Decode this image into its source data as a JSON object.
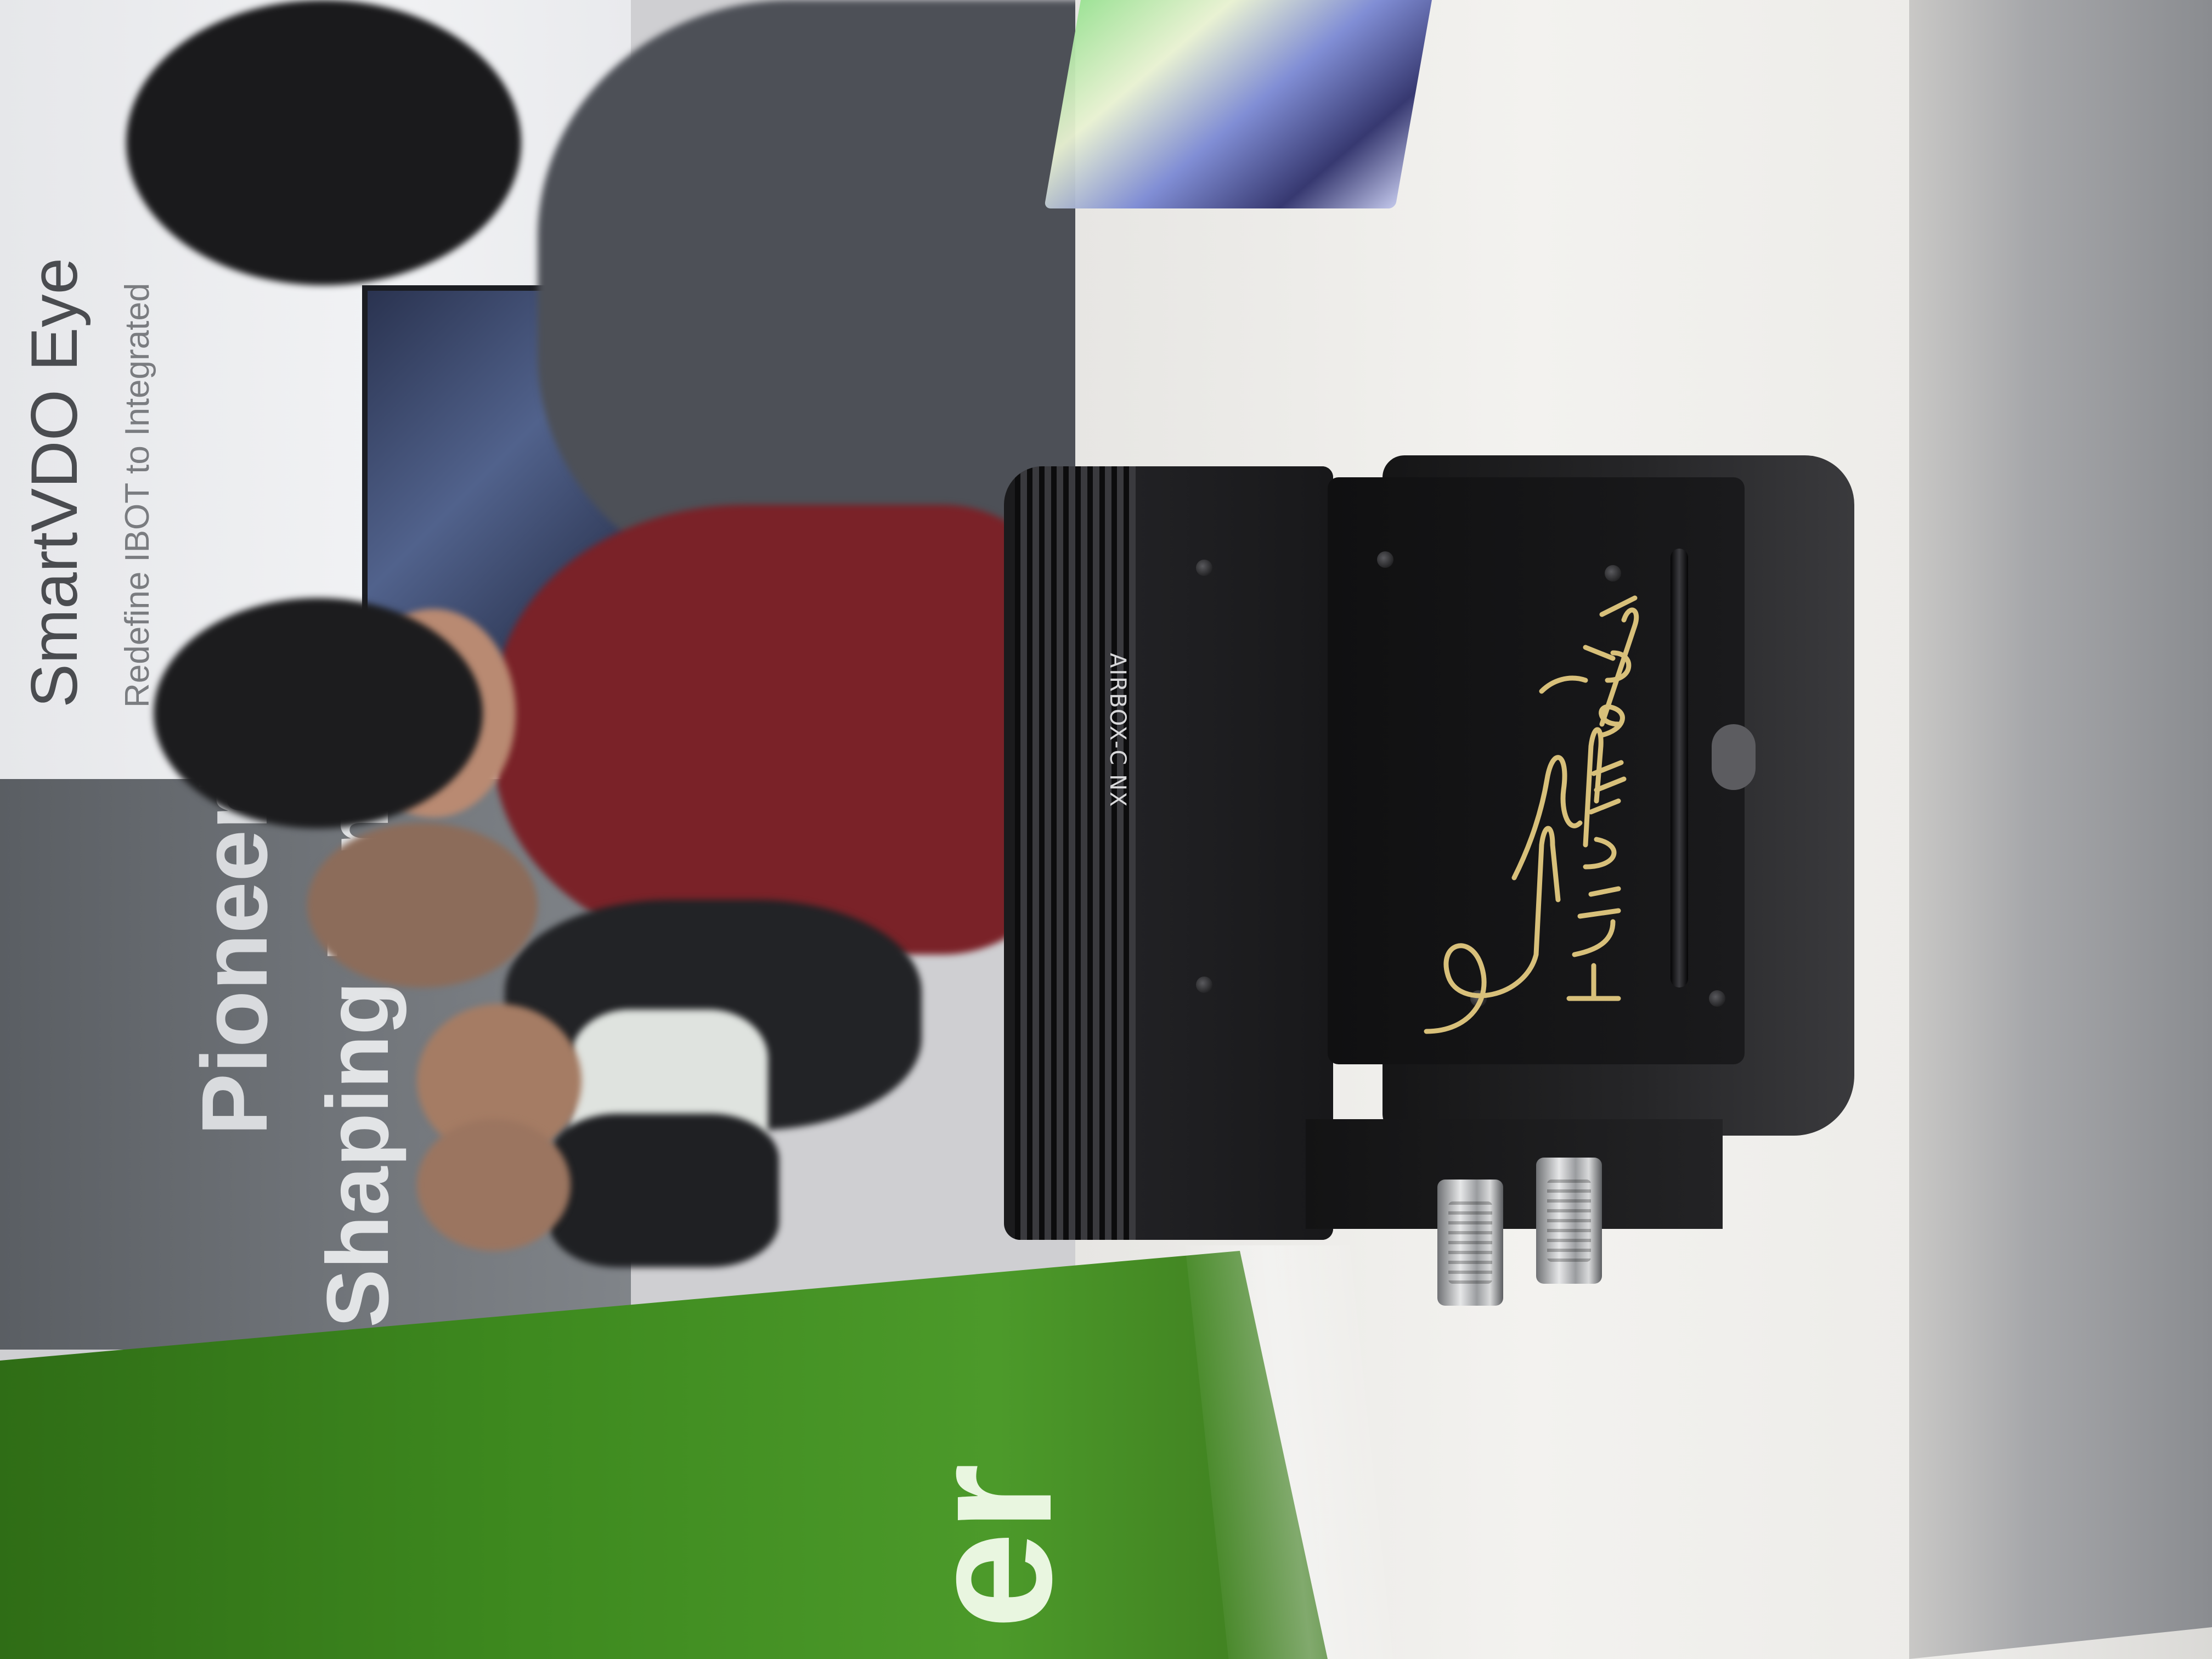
{
  "banner": {
    "title": "SmartVDO Eye",
    "subtitle": "Redefine IBOT to Integrated",
    "headline_1": "Pioneerin",
    "headline_2": "Shaping Tom"
  },
  "panel": {
    "letters": "er"
  },
  "device": {
    "model_label": "AIRBOX-C NX",
    "signature_text": "Jensen Huang",
    "signature_date": "JUNE 3. 2024"
  },
  "colors": {
    "panel_green": "#3e8a1f",
    "device_black": "#1a1a1c",
    "signature_gold": "#d8c07a"
  }
}
